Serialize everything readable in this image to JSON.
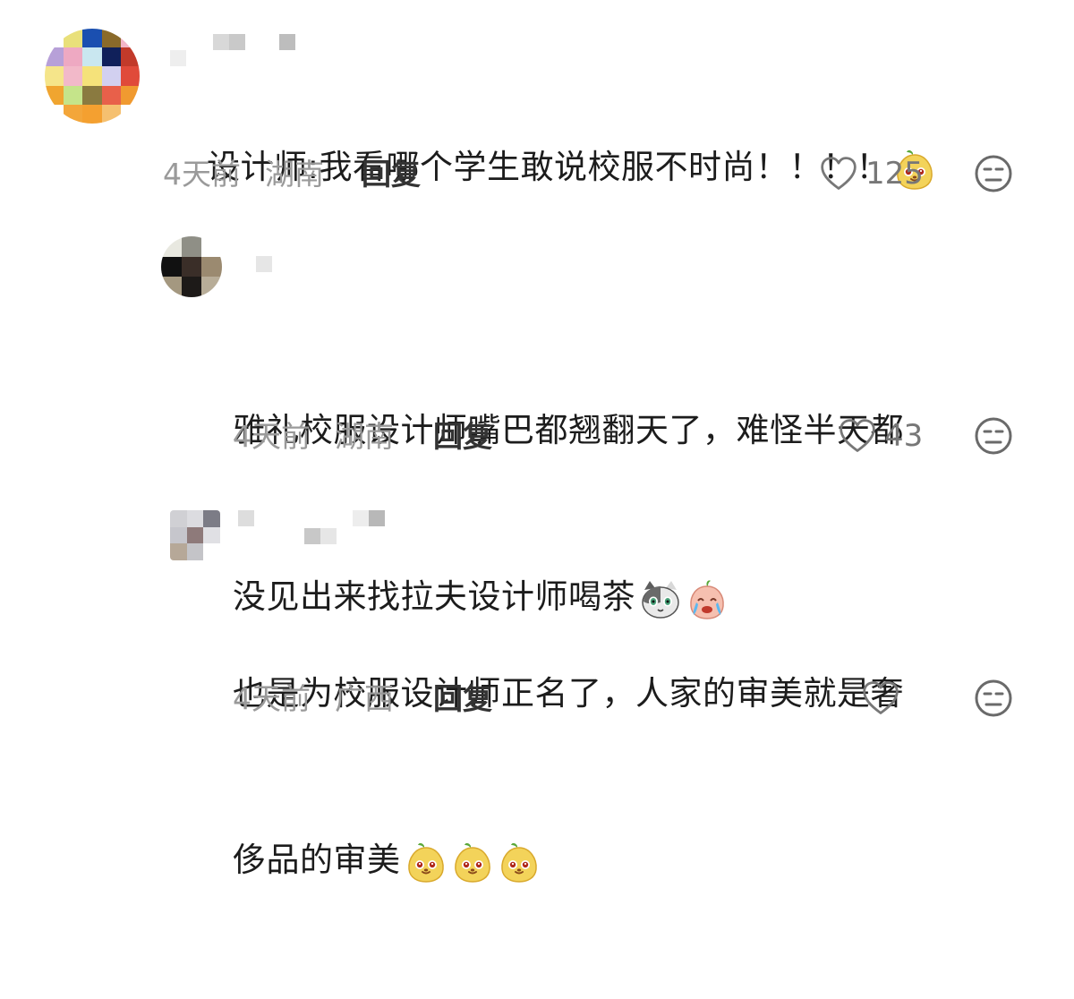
{
  "comments": [
    {
      "text": "设计师:我看哪个学生敢说校服不时尚！！！！",
      "emojis": [
        "mango-face-emoji"
      ],
      "time": "4天前",
      "location": "湖南",
      "reply_label": "回复",
      "likes": "125"
    },
    {
      "text_line1": "雅礼校服设计师嘴巴都翘翻天了，难怪半天都",
      "text_line2": "没见出来找拉夫设计师喝茶",
      "emojis": [
        "cat-face-emoji",
        "crying-peach-emoji"
      ],
      "time": "4天前",
      "location": "湖南",
      "reply_label": "回复",
      "likes": "43"
    },
    {
      "text_line1": "也是为校服设计师正名了，人家的审美就是奢",
      "text_line2": "侈品的审美",
      "emojis": [
        "mango-face-emoji",
        "mango-face-emoji",
        "mango-face-emoji"
      ],
      "time": "4天前",
      "location": "广西",
      "reply_label": "回复",
      "likes": ""
    }
  ],
  "colors": {
    "meta": "#9a9a9a",
    "text": "#1c1c1c",
    "icon": "#777777"
  }
}
